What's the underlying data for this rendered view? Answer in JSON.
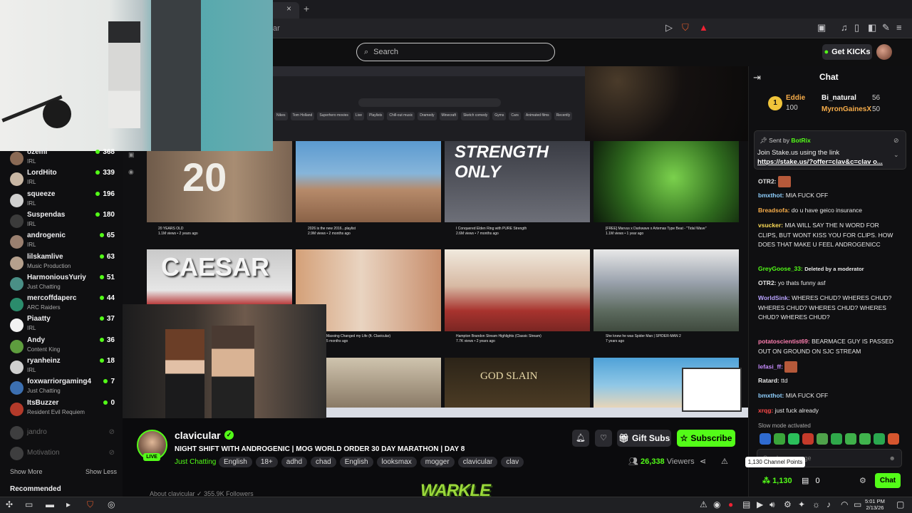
{
  "browser": {
    "tab_close": "×",
    "tab_new": "+",
    "url_fragment": "ar",
    "tool_icons": [
      "play",
      "shield",
      "bolt",
      "media",
      "library",
      "window",
      "sidebar",
      "extensions",
      "menu"
    ]
  },
  "header": {
    "search_placeholder": "Search",
    "get_kicks": "Get KICKs"
  },
  "video": {
    "yt_chips": [
      "Nikes",
      "Tom Holland",
      "Superhero movies",
      "Live",
      "Playlists",
      "Chill-out music",
      "Dramedy",
      "Minecraft",
      "Sketch comedy",
      "Gyms",
      "Cars",
      "Animated films",
      "Recently"
    ],
    "thumb_titles": {
      "t1_big": "20",
      "t3": "STRENGTH ONLY",
      "t5": "CAESAR",
      "t10": "GOD SLAIN"
    },
    "meta": [
      {
        "title": "20 YEARS OLD",
        "sub": "1.1M views • 2 years ago"
      },
      {
        "title": "2026 is the new 2016...playlist",
        "sub": "2.9M views • 2 months ago"
      },
      {
        "title": "I Conquered Elden Ring with PURE Strength",
        "sub": "2.6M views • 7 months ago"
      },
      {
        "title": "[FREE] Marvus x Darkwave x Artemas Type Beat - \"Tidal Wave\"",
        "sub": "1.1M views • 1 year ago"
      },
      {
        "title": "Maxxing Changed my Life (ft. Clavicular)",
        "sub": "5 months ago"
      },
      {
        "title": "Hampton Brandon Stream Highlights (Classic Stream)",
        "sub": "7.7K views • 2 years ago"
      },
      {
        "title": "She knew he was Spider Man | SPIDER-MAN 2",
        "sub": "7 years ago"
      }
    ]
  },
  "sidebar": {
    "following": [
      {
        "name": "ozemi",
        "category": "IRL",
        "viewers": "368",
        "color": "#8a6a55"
      },
      {
        "name": "LordHito",
        "category": "IRL",
        "viewers": "339",
        "color": "#c9b7a4"
      },
      {
        "name": "squeeze",
        "category": "IRL",
        "viewers": "196",
        "color": "#d0d0d0"
      },
      {
        "name": "Suspendas",
        "category": "IRL",
        "viewers": "180",
        "color": "#3b3b3b"
      },
      {
        "name": "androgenic",
        "category": "IRL",
        "viewers": "65",
        "color": "#9a8070"
      },
      {
        "name": "lilskamlive",
        "category": "Music Production",
        "viewers": "63",
        "color": "#b5a08d"
      },
      {
        "name": "HarmoniousYuriy",
        "category": "Just Chatting",
        "viewers": "51",
        "color": "#4a8f86"
      },
      {
        "name": "mercoffdaperc",
        "category": "ARC Raiders",
        "viewers": "44",
        "color": "#2b8c6c"
      },
      {
        "name": "Piaatty",
        "category": "IRL",
        "viewers": "37",
        "color": "#f2f2f2"
      },
      {
        "name": "Andy",
        "category": "Content King",
        "viewers": "36",
        "color": "#5e9d3e"
      },
      {
        "name": "ryanheinz",
        "category": "IRL",
        "viewers": "18",
        "color": "#cfcfcf"
      },
      {
        "name": "foxwarriorgaming4",
        "category": "Just Chatting",
        "viewers": "7",
        "color": "#3c6fb0"
      },
      {
        "name": "ItsBuzzer",
        "category": "Resident Evil Requiem",
        "viewers": "0",
        "color": "#b33a2a"
      }
    ],
    "offline": [
      {
        "name": "jandro"
      },
      {
        "name": "Motivation"
      }
    ],
    "show_more": "Show More",
    "show_less": "Show Less",
    "recommended": "Recommended"
  },
  "stream": {
    "channel": "clavicular",
    "live": "LIVE",
    "title": "NIGHT SHIFT WITH ANDROGENIC | MOG WORLD ORDER 30 DAY MARATHON | DAY 8",
    "category": "Just Chatting",
    "tags": [
      "English",
      "18+",
      "adhd",
      "chad",
      "English",
      "looksmax",
      "mogger",
      "clavicular",
      "clav"
    ],
    "gift_subs": "Gift Subs",
    "subscribe": "Subscribe",
    "viewers": "26,338",
    "viewers_label": "Viewers",
    "about_partial": "About clavicular  ✓  355.9K Followers",
    "overlay_logo": "WARKLE"
  },
  "chat": {
    "title": "Chat",
    "leaderboard": {
      "rank": "1",
      "user1": "Eddie",
      "user1_points": "100",
      "user2": "Bi_natural",
      "user2_points": "56",
      "user3": "MyronGainesX",
      "user3_points": "50"
    },
    "pinned": {
      "sent_by": "Sent by",
      "sender": "BotRix",
      "text": "Join Stake.us using the link",
      "link": "https://stake.us/?offer=clav&c=clav o..."
    },
    "messages": [
      {
        "user": "OTR2:",
        "text": "",
        "color": "#e8e8e8"
      },
      {
        "user": "bmxthot:",
        "text": "MIA FUCK OFF",
        "color": "#8fd0ff"
      },
      {
        "user": "Breadsofa:",
        "text": "do u have geico insurance",
        "color": "#f7ad4a"
      },
      {
        "user": "vsucker:",
        "text": "MIA WILL SAY THE N WORD FOR CLIPS, BUT WONT KISS YOU FOR CLIPS. HOW DOES THAT MAKE U FEEL ANDROGENICC",
        "color": "#ffdd57"
      },
      {
        "user": "GreyGoose_33:",
        "text": "Deleted by a moderator",
        "color": "#53fc18"
      },
      {
        "user": "OTR2:",
        "text": "yo thats funny asf",
        "color": "#e8e8e8"
      },
      {
        "user": "WorldSink:",
        "text": "WHERES CHUD? WHERES CHUD? WHERES CHUD? WHERES CHUD? WHERES CHUD? WHERES CHUD?",
        "color": "#b9a4ff"
      },
      {
        "user": "potatoscientist69:",
        "text": "BEARMACE GUY IS PASSED OUT ON GROUND ON SJC STREAM",
        "color": "#ff7fb0"
      },
      {
        "user": "lefasi_ff:",
        "text": "",
        "color": "#c78cff"
      },
      {
        "user": "Ratard:",
        "text": "ttd",
        "color": "#e8e8e8"
      },
      {
        "user": "bmxthot:",
        "text": "MIA FUCK OFF",
        "color": "#8fd0ff"
      },
      {
        "user": "xrqg:",
        "text": "just fuck already",
        "color": "#ff4a4a"
      }
    ],
    "slow_mode": "Slow mode activated",
    "input_placeholder": "Send a message",
    "tooltip": "1,130 Channel Points",
    "points": "1,130",
    "kicks": "0",
    "chat_button": "Chat"
  },
  "os": {
    "clock_time": "5:01 PM",
    "clock_date": "2/13/26"
  }
}
